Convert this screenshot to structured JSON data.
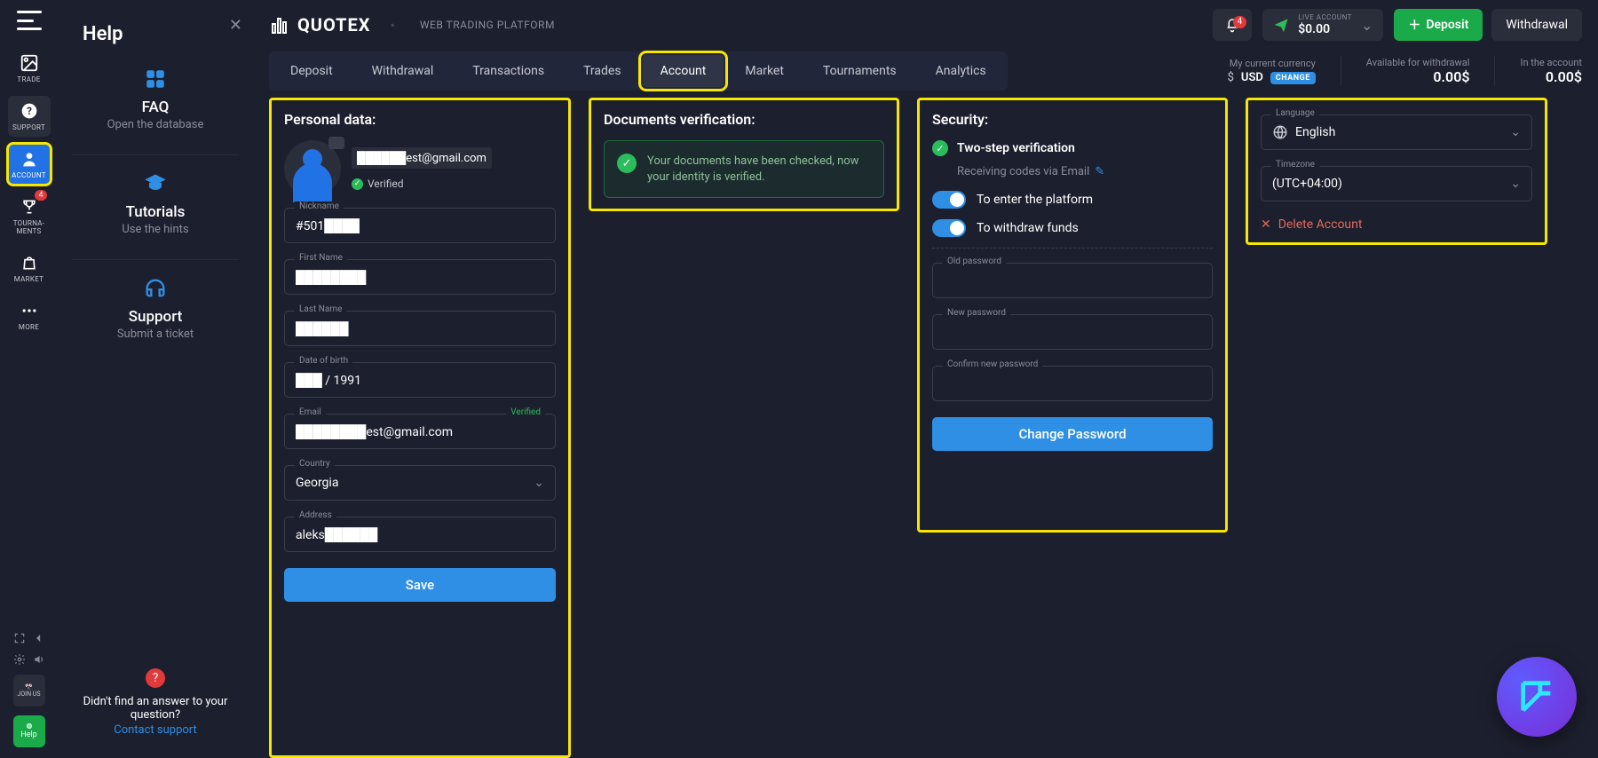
{
  "rail": {
    "trade": "TRADE",
    "support": "SUPPORT",
    "account": "ACCOUNT",
    "tournaments": "TOURNA-\nMENTS",
    "tournaments_line1": "TOURNA-",
    "tournaments_line2": "MENTS",
    "market": "MARKET",
    "more": "MORE",
    "badge4": "4",
    "joinus": "JOIN US",
    "help": "Help"
  },
  "help_panel": {
    "title": "Help",
    "faq_title": "FAQ",
    "faq_sub": "Open the database",
    "tutorials_title": "Tutorials",
    "tutorials_sub": "Use the hints",
    "support_title": "Support",
    "support_sub": "Submit a ticket",
    "foot_text": "Didn't find an answer to your question?",
    "foot_link": "Contact support"
  },
  "brand": {
    "name": "QUOTEX",
    "sub": "WEB TRADING PLATFORM"
  },
  "topbar": {
    "notif_badge": "4",
    "acct_label": "LIVE ACCOUNT",
    "acct_balance": "$0.00",
    "deposit": "Deposit",
    "withdraw": "Withdrawal"
  },
  "tabs": {
    "deposit": "Deposit",
    "withdrawal": "Withdrawal",
    "transactions": "Transactions",
    "trades": "Trades",
    "account": "Account",
    "market": "Market",
    "tournaments": "Tournaments",
    "analytics": "Analytics"
  },
  "metrics": {
    "cur_label": "My current currency",
    "cur_symbol": "$",
    "cur_code": "USD",
    "change": "CHANGE",
    "avail_label": "Available for withdrawal",
    "avail_value": "0.00$",
    "in_label": "In the account",
    "in_value": "0.00$"
  },
  "personal": {
    "title": "Personal data:",
    "email_masked": "██████est@gmail.com",
    "verified": "Verified",
    "nickname_label": "Nickname",
    "nickname_value": "#501████",
    "first_label": "First Name",
    "first_value": "████████",
    "last_label": "Last Name",
    "last_value": "██████",
    "dob_label": "Date of birth",
    "dob_value": "███ / 1991",
    "email_label": "Email",
    "email_verified": "Verified",
    "email_value": "████████est@gmail.com",
    "country_label": "Country",
    "country_value": "Georgia",
    "address_label": "Address",
    "address_value": "aleks██████",
    "save": "Save"
  },
  "docs": {
    "title": "Documents verification:",
    "banner": "Your documents have been checked, now your identity is verified."
  },
  "security": {
    "title": "Security:",
    "twostep": "Two-step verification",
    "receiving": "Receiving codes via Email",
    "enter": "To enter the platform",
    "withdraw": "To withdraw funds",
    "old_label": "Old password",
    "new_label": "New password",
    "confirm_label": "Confirm new password",
    "change_btn": "Change Password"
  },
  "prefs": {
    "lang_label": "Language",
    "lang_value": "English",
    "tz_label": "Timezone",
    "tz_value": "(UTC+04:00)",
    "delete": "Delete Account"
  }
}
